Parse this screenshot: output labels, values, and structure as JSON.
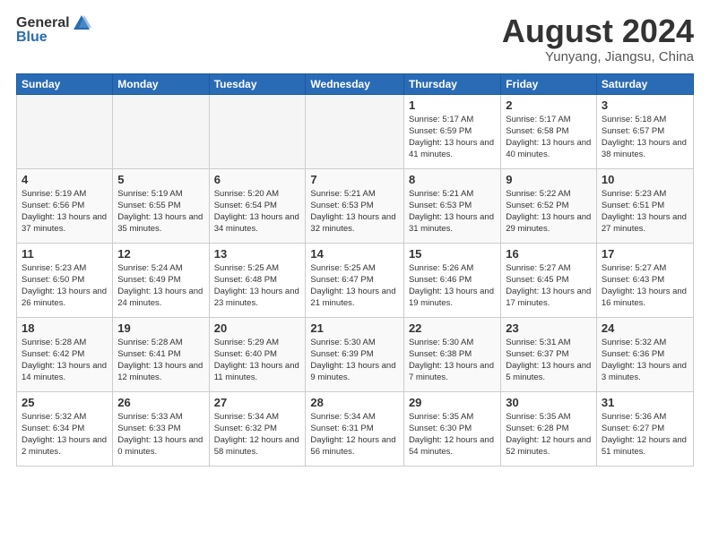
{
  "header": {
    "logo_general": "General",
    "logo_blue": "Blue",
    "month_title": "August 2024",
    "location": "Yunyang, Jiangsu, China"
  },
  "weekdays": [
    "Sunday",
    "Monday",
    "Tuesday",
    "Wednesday",
    "Thursday",
    "Friday",
    "Saturday"
  ],
  "weeks": [
    [
      {
        "day": "",
        "empty": true
      },
      {
        "day": "",
        "empty": true
      },
      {
        "day": "",
        "empty": true
      },
      {
        "day": "",
        "empty": true
      },
      {
        "day": "1",
        "info": "Sunrise: 5:17 AM\nSunset: 6:59 PM\nDaylight: 13 hours\nand 41 minutes."
      },
      {
        "day": "2",
        "info": "Sunrise: 5:17 AM\nSunset: 6:58 PM\nDaylight: 13 hours\nand 40 minutes."
      },
      {
        "day": "3",
        "info": "Sunrise: 5:18 AM\nSunset: 6:57 PM\nDaylight: 13 hours\nand 38 minutes."
      }
    ],
    [
      {
        "day": "4",
        "info": "Sunrise: 5:19 AM\nSunset: 6:56 PM\nDaylight: 13 hours\nand 37 minutes."
      },
      {
        "day": "5",
        "info": "Sunrise: 5:19 AM\nSunset: 6:55 PM\nDaylight: 13 hours\nand 35 minutes."
      },
      {
        "day": "6",
        "info": "Sunrise: 5:20 AM\nSunset: 6:54 PM\nDaylight: 13 hours\nand 34 minutes."
      },
      {
        "day": "7",
        "info": "Sunrise: 5:21 AM\nSunset: 6:53 PM\nDaylight: 13 hours\nand 32 minutes."
      },
      {
        "day": "8",
        "info": "Sunrise: 5:21 AM\nSunset: 6:53 PM\nDaylight: 13 hours\nand 31 minutes."
      },
      {
        "day": "9",
        "info": "Sunrise: 5:22 AM\nSunset: 6:52 PM\nDaylight: 13 hours\nand 29 minutes."
      },
      {
        "day": "10",
        "info": "Sunrise: 5:23 AM\nSunset: 6:51 PM\nDaylight: 13 hours\nand 27 minutes."
      }
    ],
    [
      {
        "day": "11",
        "info": "Sunrise: 5:23 AM\nSunset: 6:50 PM\nDaylight: 13 hours\nand 26 minutes."
      },
      {
        "day": "12",
        "info": "Sunrise: 5:24 AM\nSunset: 6:49 PM\nDaylight: 13 hours\nand 24 minutes."
      },
      {
        "day": "13",
        "info": "Sunrise: 5:25 AM\nSunset: 6:48 PM\nDaylight: 13 hours\nand 23 minutes."
      },
      {
        "day": "14",
        "info": "Sunrise: 5:25 AM\nSunset: 6:47 PM\nDaylight: 13 hours\nand 21 minutes."
      },
      {
        "day": "15",
        "info": "Sunrise: 5:26 AM\nSunset: 6:46 PM\nDaylight: 13 hours\nand 19 minutes."
      },
      {
        "day": "16",
        "info": "Sunrise: 5:27 AM\nSunset: 6:45 PM\nDaylight: 13 hours\nand 17 minutes."
      },
      {
        "day": "17",
        "info": "Sunrise: 5:27 AM\nSunset: 6:43 PM\nDaylight: 13 hours\nand 16 minutes."
      }
    ],
    [
      {
        "day": "18",
        "info": "Sunrise: 5:28 AM\nSunset: 6:42 PM\nDaylight: 13 hours\nand 14 minutes."
      },
      {
        "day": "19",
        "info": "Sunrise: 5:28 AM\nSunset: 6:41 PM\nDaylight: 13 hours\nand 12 minutes."
      },
      {
        "day": "20",
        "info": "Sunrise: 5:29 AM\nSunset: 6:40 PM\nDaylight: 13 hours\nand 11 minutes."
      },
      {
        "day": "21",
        "info": "Sunrise: 5:30 AM\nSunset: 6:39 PM\nDaylight: 13 hours\nand 9 minutes."
      },
      {
        "day": "22",
        "info": "Sunrise: 5:30 AM\nSunset: 6:38 PM\nDaylight: 13 hours\nand 7 minutes."
      },
      {
        "day": "23",
        "info": "Sunrise: 5:31 AM\nSunset: 6:37 PM\nDaylight: 13 hours\nand 5 minutes."
      },
      {
        "day": "24",
        "info": "Sunrise: 5:32 AM\nSunset: 6:36 PM\nDaylight: 13 hours\nand 3 minutes."
      }
    ],
    [
      {
        "day": "25",
        "info": "Sunrise: 5:32 AM\nSunset: 6:34 PM\nDaylight: 13 hours\nand 2 minutes."
      },
      {
        "day": "26",
        "info": "Sunrise: 5:33 AM\nSunset: 6:33 PM\nDaylight: 13 hours\nand 0 minutes."
      },
      {
        "day": "27",
        "info": "Sunrise: 5:34 AM\nSunset: 6:32 PM\nDaylight: 12 hours\nand 58 minutes."
      },
      {
        "day": "28",
        "info": "Sunrise: 5:34 AM\nSunset: 6:31 PM\nDaylight: 12 hours\nand 56 minutes."
      },
      {
        "day": "29",
        "info": "Sunrise: 5:35 AM\nSunset: 6:30 PM\nDaylight: 12 hours\nand 54 minutes."
      },
      {
        "day": "30",
        "info": "Sunrise: 5:35 AM\nSunset: 6:28 PM\nDaylight: 12 hours\nand 52 minutes."
      },
      {
        "day": "31",
        "info": "Sunrise: 5:36 AM\nSunset: 6:27 PM\nDaylight: 12 hours\nand 51 minutes."
      }
    ]
  ]
}
